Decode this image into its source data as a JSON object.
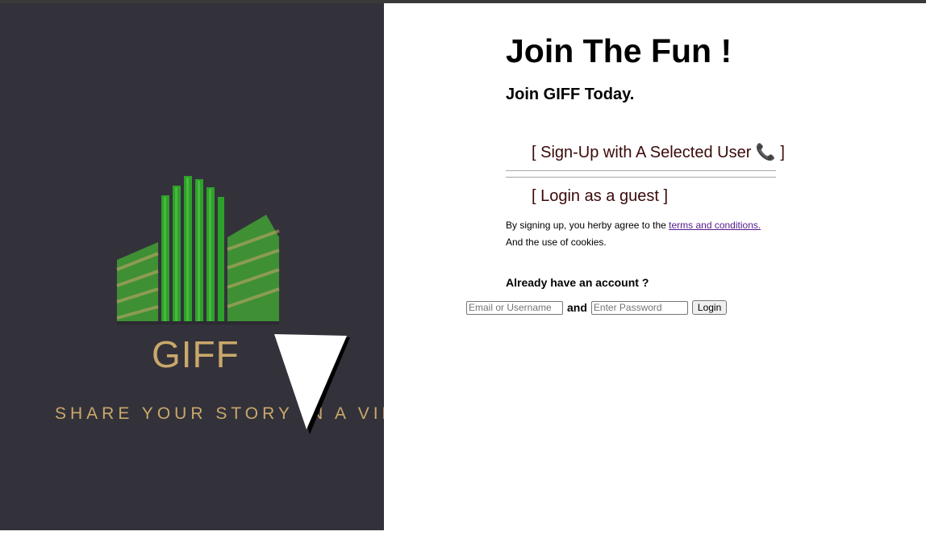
{
  "brand": {
    "logo_word": "GIFF",
    "tagline": "SHARE YOUR STORY IN A VIDEO"
  },
  "header": {
    "title": "Join The Fun !",
    "subtitle": "Join GIFF Today."
  },
  "options": {
    "signup_label": "[ Sign-Up with A Selected User 📞 ]",
    "guest_label": "[ Login as a guest ]"
  },
  "terms": {
    "prefix": "By signing up, you herby agree to the ",
    "link_text": "terms and conditions.",
    "cookies_text": "And the use of cookies."
  },
  "login": {
    "heading": "Already have an account ?",
    "username_placeholder": "Email or Username",
    "connector": "and",
    "password_placeholder": "Enter Password",
    "button_label": "Login"
  },
  "colors": {
    "left_panel_bg": "#33323b",
    "logo_gold": "#c9a86a",
    "logo_green": "#3fae3a",
    "option_link": "#3b0a0a",
    "terms_link": "#551a8b"
  },
  "icons": {
    "logo": "building-logo-icon",
    "cursor": "cursor-arrow-icon"
  }
}
